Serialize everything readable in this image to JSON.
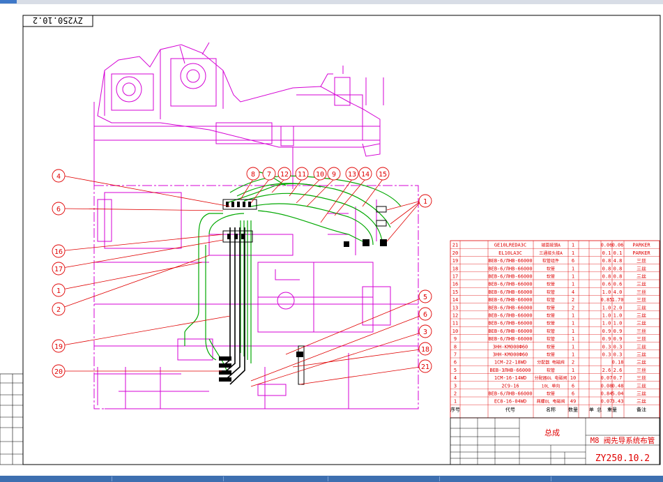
{
  "stamp_top": "ZY250.10.2",
  "callouts": {
    "c1a": "1",
    "c2": "2",
    "c4": "4",
    "c6a": "6",
    "c16": "16",
    "c17": "17",
    "c19": "19",
    "c20": "20",
    "c8": "8",
    "c7": "7",
    "c12": "12",
    "c11": "11",
    "c10a": "10",
    "c9": "9",
    "c13": "13",
    "c14": "14",
    "c15": "15",
    "c1b": "1",
    "c5": "5",
    "c6b": "6",
    "c3": "3",
    "c18": "18",
    "c21": "21",
    "c1c": "1"
  },
  "bom": {
    "rows": [
      {
        "no": "21",
        "code": "GE10LREDA3C",
        "name": "端面接頭A",
        "qty": "1",
        "w1": "0.06",
        "w2": "0.06",
        "note": "PARKER"
      },
      {
        "no": "20",
        "code": "EL10LA3C",
        "name": "三通接头接A",
        "qty": "1",
        "w1": "0.1",
        "w2": "0.1",
        "note": "PARKER"
      },
      {
        "no": "19",
        "code": "ВЕВ-6/ЛНВ-66000",
        "name": "软管组件",
        "qty": "6",
        "w1": "0.8",
        "w2": "4.8",
        "note": "三丝"
      },
      {
        "no": "18",
        "code": "ВЕВ-6/ЛНВ-66000",
        "name": "软管",
        "qty": "1",
        "w1": "0.8",
        "w2": "0.8",
        "note": "三丝"
      },
      {
        "no": "17",
        "code": "ВЕВ-6/ЛНВ-66000",
        "name": "软管",
        "qty": "1",
        "w1": "0.8",
        "w2": "0.8",
        "note": "三丝"
      },
      {
        "no": "16",
        "code": "ВЕВ-6/ЛНВ-66000",
        "name": "软管",
        "qty": "1",
        "w1": "0.6",
        "w2": "0.6",
        "note": "三丝"
      },
      {
        "no": "15",
        "code": "ВЕВ-6/ЛНВ-66000",
        "name": "软管",
        "qty": "4",
        "w1": "1.0",
        "w2": "4.0",
        "note": "三丝"
      },
      {
        "no": "14",
        "code": "ВЕВ-6/ЛНВ-66000",
        "name": "软管",
        "qty": "2",
        "w1": "0.85",
        "w2": "1.70",
        "note": "三丝"
      },
      {
        "no": "13",
        "code": "ВЕВ-6/ЛНВ-66000",
        "name": "软管",
        "qty": "2",
        "w1": "1.0",
        "w2": "2.0",
        "note": "三丝"
      },
      {
        "no": "12",
        "code": "ВЕВ-6/ЛНВ-66000",
        "name": "软管",
        "qty": "1",
        "w1": "1.0",
        "w2": "1.0",
        "note": "三丝"
      },
      {
        "no": "11",
        "code": "ВЕВ-6/ЛНВ-66000",
        "name": "软管",
        "qty": "1",
        "w1": "1.0",
        "w2": "1.0",
        "note": "三丝"
      },
      {
        "no": "10",
        "code": "ВЕВ-6/ЛНВ-66000",
        "name": "软管",
        "qty": "1",
        "w1": "0.9",
        "w2": "0.9",
        "note": "三丝"
      },
      {
        "no": "9",
        "code": "ВЕВ-6/ЛНВ-66000",
        "name": "软管",
        "qty": "1",
        "w1": "0.9",
        "w2": "0.9",
        "note": "三丝"
      },
      {
        "no": "8",
        "code": "ЗНН-КМ000Ф60",
        "name": "软管",
        "qty": "1",
        "w1": "0.3",
        "w2": "0.3",
        "note": "三丝"
      },
      {
        "no": "7",
        "code": "ЗНН-КМ000Ф60",
        "name": "软管",
        "qty": "1",
        "w1": "0.3",
        "w2": "0.3",
        "note": "三丝"
      },
      {
        "no": "6",
        "code": "1CM-22-18WD",
        "name": "分配器 电磁阀",
        "qty": "2",
        "w1": "",
        "w2": "0.18",
        "note": "三丝"
      },
      {
        "no": "5",
        "code": "ВЕВ-ЗЛНВ-66000",
        "name": "软管",
        "qty": "1",
        "w1": "2.6",
        "w2": "2.6",
        "note": "三丝"
      },
      {
        "no": "4",
        "code": "1CM-16-14WD",
        "name": "分配器OL 电磁阀",
        "qty": "10",
        "w1": "0.07",
        "w2": "0.7",
        "note": "三丝"
      },
      {
        "no": "3",
        "code": "2C9-16",
        "name": "10L 单向",
        "qty": "6",
        "w1": "0.08",
        "w2": "0.48",
        "note": "三丝"
      },
      {
        "no": "2",
        "code": "ВЕВ-6/ЛНВ-66000",
        "name": "软管",
        "qty": "6",
        "w1": "0.84",
        "w2": "5.04",
        "note": "三丝"
      },
      {
        "no": "1",
        "code": "EC8-16-04WD",
        "name": "两螺OL 电磁阀",
        "qty": "49",
        "w1": "0.07",
        "w2": "3.43",
        "note": "三丝"
      }
    ],
    "header": {
      "no": "序号",
      "code": "代号",
      "name": "名称",
      "qty": "数量",
      "unit": "单 总",
      "weight": "重量",
      "note": "备注"
    }
  },
  "title_block": {
    "assembly": "总成",
    "title": "M8 阀先导系统布管",
    "code": "ZY250.10.2"
  },
  "colors": {
    "frame": "#000000",
    "structure": "#d400d4",
    "pipes": "#00a800",
    "leaders": "#e00000",
    "fittings": "#000000",
    "table": "#e00000"
  }
}
